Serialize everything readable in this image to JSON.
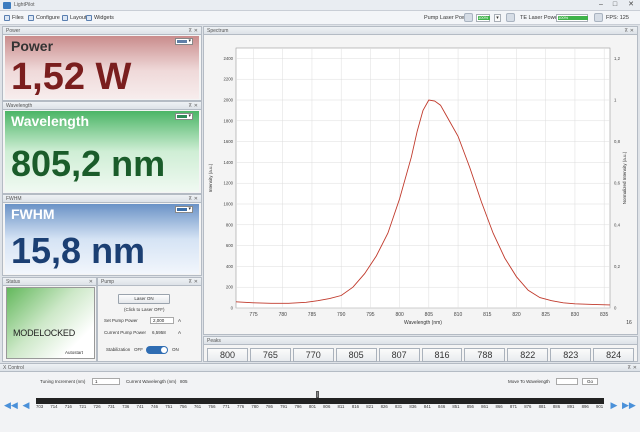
{
  "app": {
    "title": "LightPilot"
  },
  "window": {
    "minimize": "–",
    "maximize": "□",
    "close": "✕"
  },
  "menu": [
    {
      "label": "Files",
      "icon": "file-icon"
    },
    {
      "label": "Configure",
      "icon": "configure-icon"
    },
    {
      "label": "Layout",
      "icon": "layout-icon"
    },
    {
      "label": "Widgets",
      "icon": "widgets-icon"
    }
  ],
  "toolbar": {
    "pump_label": "Pump Laser Power",
    "pump_value": "100%",
    "te_label": "TE Laser Power",
    "te_value": "100%",
    "fps": "FPS: 125"
  },
  "power": {
    "header": "Power",
    "label": "Power",
    "value": "1,52 W",
    "color": "#c88a8a",
    "bg": "#efd9d9"
  },
  "wavelength": {
    "header": "Wavelength",
    "label": "Wavelength",
    "value": "805,2 nm",
    "color": "#4bb566",
    "bg": "#d7efdc"
  },
  "fwhm": {
    "header": "FWHM",
    "label": "FWHM",
    "value": "15,8 nm",
    "color": "#6a92c6",
    "bg": "#d5e3f4"
  },
  "status": {
    "header": "Status",
    "text": "MODELOCKED",
    "autostart": "Autostart"
  },
  "pump": {
    "header": "Pump",
    "laser_button": "Laser ON",
    "hint": "(Click to Laser OFF)",
    "set_label": "Set Pump Power",
    "set_value": "2,000",
    "set_unit": "A",
    "current_label": "Current Pump Power",
    "current_value": "6,5958",
    "current_unit": "A",
    "stab_label": "Stabilization",
    "stab_off": "OFF",
    "stab_on": "ON"
  },
  "spectrum": {
    "header": "Spectrum",
    "side_number": "16"
  },
  "chart_data": {
    "type": "line",
    "xlabel": "Wavelength (nm)",
    "ylabel": "Intensity (a.u.)",
    "ylabel_right": "Normalized Intensity (a.u.)",
    "xlim": [
      772,
      836
    ],
    "ylim": [
      0,
      2500
    ],
    "ylim_right": [
      0,
      1.25
    ],
    "xticks": [
      "775",
      "780",
      "785",
      "790",
      "795",
      "800",
      "805",
      "810",
      "815",
      "820",
      "825",
      "830",
      "835"
    ],
    "xtick_values": [
      775,
      780,
      785,
      790,
      795,
      800,
      805,
      810,
      815,
      820,
      825,
      830,
      835
    ],
    "yticks": [
      "0",
      "200",
      "400",
      "600",
      "800",
      "1000",
      "1200",
      "1400",
      "1600",
      "1800",
      "2000",
      "2200",
      "2400"
    ],
    "ytick_values": [
      0,
      200,
      400,
      600,
      800,
      1000,
      1200,
      1400,
      1600,
      1800,
      2000,
      2200,
      2400
    ],
    "yticks_right": [
      "0",
      "0,2",
      "0,4",
      "0,6",
      "0,8",
      "1",
      "1,2"
    ],
    "ytick_right_values": [
      0,
      0.2,
      0.4,
      0.6,
      0.8,
      1.0,
      1.2
    ],
    "grid": true,
    "series": [
      {
        "color": "#c0392b",
        "x": [
          772,
          775,
          778,
          781,
          784,
          786,
          788,
          790,
          792,
          794,
          796,
          798,
          800,
          802,
          803,
          804,
          805,
          806,
          807,
          808,
          810,
          812,
          814,
          816,
          818,
          820,
          822,
          824,
          826,
          828,
          830,
          833,
          836
        ],
        "y": [
          60,
          50,
          45,
          45,
          55,
          70,
          90,
          120,
          200,
          330,
          500,
          720,
          1050,
          1450,
          1700,
          1900,
          2000,
          1990,
          1950,
          1850,
          1650,
          1350,
          1020,
          720,
          480,
          300,
          170,
          100,
          70,
          50,
          40,
          35,
          30
        ]
      }
    ]
  },
  "peaks": {
    "header": "Peaks",
    "values": [
      "800",
      "765",
      "770",
      "805",
      "807",
      "816",
      "788",
      "822",
      "823",
      "824"
    ]
  },
  "xcontrol": {
    "header": "X Control",
    "tuning_label": "Tuning Increment (nm)",
    "tuning_value": "1",
    "current_label": "Current Wavelength (nm)",
    "current_value": "805",
    "move_label": "Move To Wavelength",
    "go": "Go",
    "scale": [
      "703",
      "714",
      "716",
      "721",
      "726",
      "731",
      "736",
      "741",
      "746",
      "751",
      "756",
      "761",
      "766",
      "771",
      "776",
      "780",
      "786",
      "791",
      "796",
      "801",
      "806",
      "811",
      "816",
      "821",
      "826",
      "831",
      "836",
      "841",
      "846",
      "851",
      "856",
      "861",
      "866",
      "871",
      "876",
      "881",
      "886",
      "891",
      "896",
      "901"
    ]
  }
}
